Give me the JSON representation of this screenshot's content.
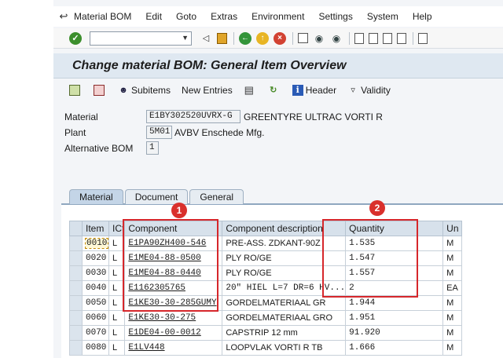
{
  "menubar": {
    "items": [
      "Material BOM",
      "Edit",
      "Goto",
      "Extras",
      "Environment",
      "Settings",
      "System",
      "Help"
    ]
  },
  "title": "Change material BOM: General Item Overview",
  "app_toolbar": {
    "subitems": "Subitems",
    "new_entries": "New Entries",
    "header": "Header",
    "validity": "Validity"
  },
  "header_fields": {
    "material_label": "Material",
    "material_value": "E1BY302520UVRX-G",
    "material_desc": "GREENTYRE  ULTRAC VORTI R",
    "plant_label": "Plant",
    "plant_value": "5M01",
    "plant_desc": "AVBV Enschede Mfg.",
    "altbom_label": "Alternative BOM",
    "altbom_value": "1"
  },
  "tabs": [
    "Material",
    "Document",
    "General"
  ],
  "grid": {
    "headers": [
      "Item",
      "ICt",
      "Component",
      "Component description",
      "Quantity",
      "Un"
    ],
    "rows": [
      [
        "0010",
        "L",
        "E1PA90ZH400-546",
        "PRE-ASS.  ZDKANT-90Z",
        "1.535",
        "M"
      ],
      [
        "0020",
        "L",
        "E1ME04-88-0500",
        "PLY RO/GE",
        "1.547",
        "M"
      ],
      [
        "0030",
        "L",
        "E1ME04-88-0440",
        "PLY RO/GE",
        "1.557",
        "M"
      ],
      [
        "0040",
        "L",
        "E1162305765",
        "20\" HIEL  L=7 DR=6 HV...",
        "2",
        "EA"
      ],
      [
        "0050",
        "L",
        "E1KE30-30-285GUMY",
        "GORDELMATERIAAL GR",
        "1.944",
        "M"
      ],
      [
        "0060",
        "L",
        "E1KE30-30-275",
        "GORDELMATERIAAL GRO",
        "1.951",
        "M"
      ],
      [
        "0070",
        "L",
        "E1DE04-00-0012",
        "CAPSTRIP 12 mm",
        "91.920",
        "M"
      ],
      [
        "0080",
        "L",
        "E1LV448",
        "LOOPVLAK VORTI R TB",
        "1.666",
        "M"
      ]
    ]
  },
  "annotations": [
    {
      "number": "1",
      "target": "Component"
    },
    {
      "number": "2",
      "target": "Quantity"
    }
  ],
  "colors": {
    "annotation_red": "#d6272b",
    "title_bar": "#dfe8f1",
    "grid_header": "#d7e1eb"
  }
}
